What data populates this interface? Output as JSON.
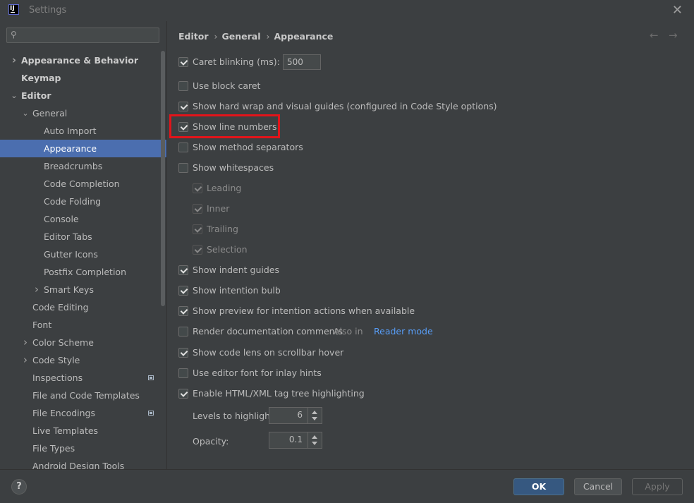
{
  "window": {
    "title": "Settings",
    "app_icon_text": "IJ"
  },
  "search": {
    "value": "",
    "placeholder": ""
  },
  "sidebar": {
    "items": [
      {
        "label": "Appearance & Behavior",
        "indent": 0,
        "chevron": "right",
        "bold": true
      },
      {
        "label": "Keymap",
        "indent": 0,
        "chevron": "",
        "bold": true
      },
      {
        "label": "Editor",
        "indent": 0,
        "chevron": "down",
        "bold": true
      },
      {
        "label": "General",
        "indent": 1,
        "chevron": "down",
        "bold": false
      },
      {
        "label": "Auto Import",
        "indent": 2,
        "chevron": "",
        "bold": false
      },
      {
        "label": "Appearance",
        "indent": 2,
        "chevron": "",
        "bold": false,
        "selected": true
      },
      {
        "label": "Breadcrumbs",
        "indent": 2,
        "chevron": "",
        "bold": false
      },
      {
        "label": "Code Completion",
        "indent": 2,
        "chevron": "",
        "bold": false
      },
      {
        "label": "Code Folding",
        "indent": 2,
        "chevron": "",
        "bold": false
      },
      {
        "label": "Console",
        "indent": 2,
        "chevron": "",
        "bold": false
      },
      {
        "label": "Editor Tabs",
        "indent": 2,
        "chevron": "",
        "bold": false
      },
      {
        "label": "Gutter Icons",
        "indent": 2,
        "chevron": "",
        "bold": false
      },
      {
        "label": "Postfix Completion",
        "indent": 2,
        "chevron": "",
        "bold": false
      },
      {
        "label": "Smart Keys",
        "indent": 2,
        "chevron": "right",
        "bold": false
      },
      {
        "label": "Code Editing",
        "indent": 1,
        "chevron": "",
        "bold": false
      },
      {
        "label": "Font",
        "indent": 1,
        "chevron": "",
        "bold": false
      },
      {
        "label": "Color Scheme",
        "indent": 1,
        "chevron": "right",
        "bold": false
      },
      {
        "label": "Code Style",
        "indent": 1,
        "chevron": "right",
        "bold": false
      },
      {
        "label": "Inspections",
        "indent": 1,
        "chevron": "",
        "bold": false,
        "badge": true
      },
      {
        "label": "File and Code Templates",
        "indent": 1,
        "chevron": "",
        "bold": false
      },
      {
        "label": "File Encodings",
        "indent": 1,
        "chevron": "",
        "bold": false,
        "badge": true
      },
      {
        "label": "Live Templates",
        "indent": 1,
        "chevron": "",
        "bold": false
      },
      {
        "label": "File Types",
        "indent": 1,
        "chevron": "",
        "bold": false
      },
      {
        "label": "Android Design Tools",
        "indent": 1,
        "chevron": "",
        "bold": false
      }
    ]
  },
  "breadcrumb": {
    "items": [
      "Editor",
      "General",
      "Appearance"
    ]
  },
  "options": {
    "caret_blinking": {
      "label": "Caret blinking (ms):",
      "checked": true,
      "value": "500"
    },
    "block_caret": {
      "label": "Use block caret",
      "checked": false
    },
    "hard_wrap": {
      "label": "Show hard wrap and visual guides (configured in Code Style options)",
      "checked": true
    },
    "line_numbers": {
      "label": "Show line numbers",
      "checked": true
    },
    "method_separators": {
      "label": "Show method separators",
      "checked": false
    },
    "whitespaces": {
      "label": "Show whitespaces",
      "checked": false
    },
    "leading": {
      "label": "Leading",
      "checked": true,
      "disabled": true
    },
    "inner": {
      "label": "Inner",
      "checked": true,
      "disabled": true
    },
    "trailing": {
      "label": "Trailing",
      "checked": true,
      "disabled": true
    },
    "selection": {
      "label": "Selection",
      "checked": true,
      "disabled": true
    },
    "indent_guides": {
      "label": "Show indent guides",
      "checked": true
    },
    "intention_bulb": {
      "label": "Show intention bulb",
      "checked": true
    },
    "intention_preview": {
      "label": "Show preview for intention actions when available",
      "checked": true
    },
    "render_docs": {
      "label": "Render documentation comments",
      "checked": false,
      "also_text": "Also in",
      "link": "Reader mode"
    },
    "code_lens": {
      "label": "Show code lens on scrollbar hover",
      "checked": true
    },
    "editor_font": {
      "label": "Use editor font for inlay hints",
      "checked": false
    },
    "tag_tree": {
      "label": "Enable HTML/XML tag tree highlighting",
      "checked": true
    },
    "levels": {
      "label": "Levels to highlight:",
      "value": "6"
    },
    "opacity": {
      "label": "Opacity:",
      "value": "0.1"
    }
  },
  "footer": {
    "help": "?",
    "ok": "OK",
    "cancel": "Cancel",
    "apply": "Apply"
  },
  "colors": {
    "selection": "#4b6eaf",
    "highlight_box": "#e2141a",
    "link": "#589df6",
    "ok_button": "#365880"
  }
}
